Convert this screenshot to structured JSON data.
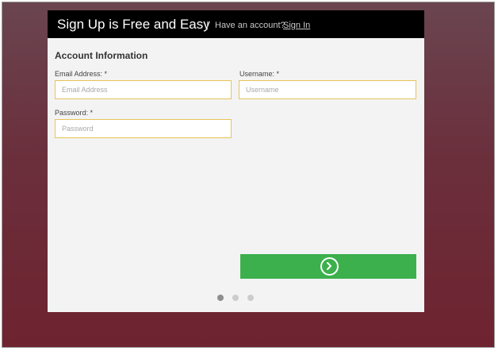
{
  "header": {
    "title": "Sign Up is Free and Easy",
    "separator": "|",
    "have_account_text": "Have an account?",
    "sign_in_label": "Sign In"
  },
  "form": {
    "section_title": "Account Information",
    "email": {
      "label": "Email Address: *",
      "placeholder": "Email Address",
      "value": ""
    },
    "username": {
      "label": "Username: *",
      "placeholder": "Username",
      "value": ""
    },
    "password": {
      "label": "Password: *",
      "placeholder": "Password",
      "value": ""
    }
  },
  "next_button": {
    "icon": "chevron-right-icon"
  },
  "pagination": {
    "total_steps": 3,
    "current_step": 1
  },
  "colors": {
    "header_bg": "#000000",
    "card_bg": "#f3f3f3",
    "input_border": "#e8c35a",
    "button_bg": "#3cb04c",
    "backdrop_top": "#6a4550",
    "backdrop_bottom": "#6e2330"
  }
}
